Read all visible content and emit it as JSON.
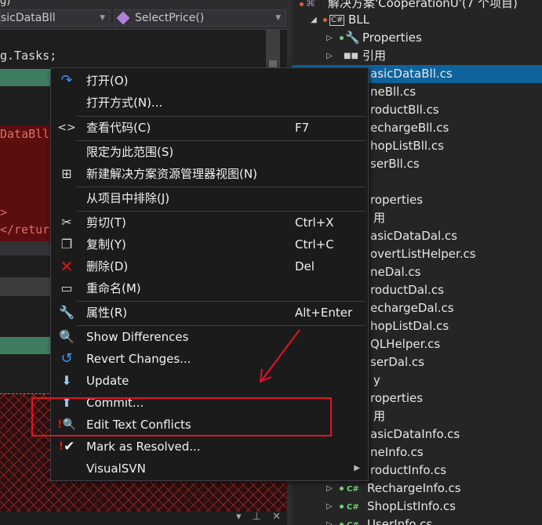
{
  "editor": {
    "top_text": "g)",
    "class_combo": "sicDataBll",
    "method_combo": "SelectPrice()",
    "code_using": "g.Tasks;",
    "red_code1": "DataBll",
    "red_code2": ">",
    "red_code3": "</retur"
  },
  "explorer": {
    "rows": [
      {
        "label": "解决方案'CooperationU'(7 个项目)"
      },
      {
        "label": "BLL"
      },
      {
        "label": "Properties"
      },
      {
        "label": "引用"
      },
      {
        "label": "asicDataBll.cs"
      },
      {
        "label": "neBll.cs"
      },
      {
        "label": "roductBll.cs"
      },
      {
        "label": "echargeBll.cs"
      },
      {
        "label": "hopListBll.cs"
      },
      {
        "label": "serBll.cs"
      },
      {
        "label": "roperties"
      },
      {
        "label": "用"
      },
      {
        "label": "asicDataDal.cs"
      },
      {
        "label": "overtListHelper.cs"
      },
      {
        "label": "neDal.cs"
      },
      {
        "label": "roductDal.cs"
      },
      {
        "label": "echargeDal.cs"
      },
      {
        "label": "hopListDal.cs"
      },
      {
        "label": "QLHelper.cs"
      },
      {
        "label": "serDal.cs"
      },
      {
        "label": "y"
      },
      {
        "label": "roperties"
      },
      {
        "label": "用"
      },
      {
        "label": "asicDataInfo.cs"
      },
      {
        "label": "neInfo.cs"
      },
      {
        "label": "roductInfo.cs"
      },
      {
        "label": "RechargeInfo.cs"
      },
      {
        "label": "ShopListInfo.cs"
      },
      {
        "label": "UserInfo.cs"
      }
    ],
    "cs_badge": "C#"
  },
  "menu": {
    "items": [
      {
        "label": "打开(O)",
        "shortcut": ""
      },
      {
        "label": "打开方式(N)...",
        "shortcut": ""
      },
      {
        "label": "查看代码(C)",
        "shortcut": "F7"
      },
      {
        "label": "限定为此范围(S)",
        "shortcut": ""
      },
      {
        "label": "新建解决方案资源管理器视图(N)",
        "shortcut": ""
      },
      {
        "label": "从项目中排除(J)",
        "shortcut": ""
      },
      {
        "label": "剪切(T)",
        "shortcut": "Ctrl+X"
      },
      {
        "label": "复制(Y)",
        "shortcut": "Ctrl+C"
      },
      {
        "label": "删除(D)",
        "shortcut": "Del"
      },
      {
        "label": "重命名(M)",
        "shortcut": ""
      },
      {
        "label": "属性(R)",
        "shortcut": "Alt+Enter"
      },
      {
        "label": "Show Differences",
        "shortcut": ""
      },
      {
        "label": "Revert Changes...",
        "shortcut": ""
      },
      {
        "label": "Update",
        "shortcut": ""
      },
      {
        "label": "Commit...",
        "shortcut": ""
      },
      {
        "label": "Edit Text Conflicts",
        "shortcut": ""
      },
      {
        "label": "Mark as Resolved...",
        "shortcut": ""
      },
      {
        "label": "VisualSVN",
        "shortcut": ""
      }
    ]
  },
  "colors": {
    "selection": "#0e639c",
    "annotation": "#e81123",
    "cs_green": "#6fd36f"
  }
}
